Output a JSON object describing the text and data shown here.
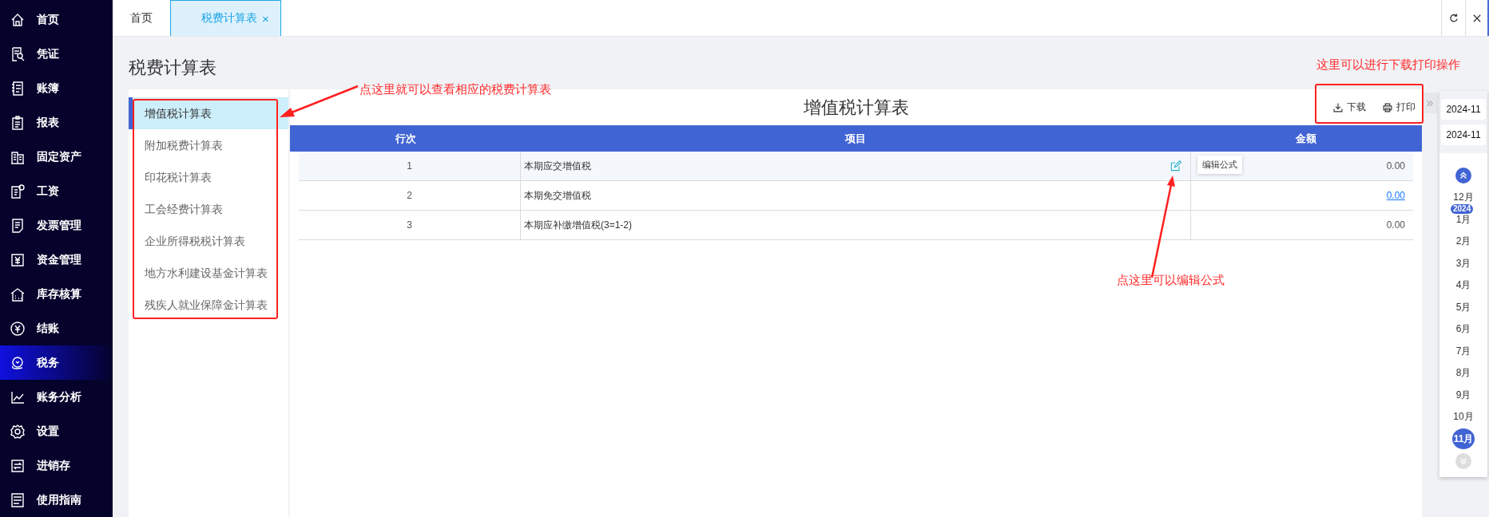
{
  "sidebar": {
    "items": [
      {
        "label": "首页",
        "selected": false
      },
      {
        "label": "凭证",
        "selected": false
      },
      {
        "label": "账簿",
        "selected": false
      },
      {
        "label": "报表",
        "selected": false
      },
      {
        "label": "固定资产",
        "selected": false
      },
      {
        "label": "工资",
        "selected": false
      },
      {
        "label": "发票管理",
        "selected": false
      },
      {
        "label": "资金管理",
        "selected": false
      },
      {
        "label": "库存核算",
        "selected": false
      },
      {
        "label": "结账",
        "selected": false
      },
      {
        "label": "税务",
        "selected": true
      },
      {
        "label": "账务分析",
        "selected": false
      },
      {
        "label": "设置",
        "selected": false
      },
      {
        "label": "进销存",
        "selected": false
      },
      {
        "label": "使用指南",
        "selected": false
      }
    ]
  },
  "tabs": [
    {
      "label": "首页",
      "selected": false,
      "closable": false
    },
    {
      "label": "税费计算表",
      "selected": true,
      "closable": true
    }
  ],
  "tab_close": "×",
  "page_title": "税费计算表",
  "report_list": [
    {
      "label": "增值税计算表",
      "selected": true
    },
    {
      "label": "附加税费计算表",
      "selected": false
    },
    {
      "label": "印花税计算表",
      "selected": false
    },
    {
      "label": "工会经费计算表",
      "selected": false
    },
    {
      "label": "企业所得税税计算表",
      "selected": false
    },
    {
      "label": "地方水利建设基金计算表",
      "selected": false
    },
    {
      "label": "残疾人就业保障金计算表",
      "selected": false
    }
  ],
  "report": {
    "title": "增值税计算表",
    "actions": [
      {
        "label": "下载",
        "kind": "download"
      },
      {
        "label": "打印",
        "kind": "print"
      }
    ],
    "columns": [
      "行次",
      "项目",
      "金额"
    ],
    "rows": [
      {
        "line": "1",
        "item": "本期应交增值税",
        "amount": "0.00",
        "amount_link": false,
        "hovered": true
      },
      {
        "line": "2",
        "item": "本期免交增值税",
        "amount": "0.00",
        "amount_link": true,
        "hovered": false
      },
      {
        "line": "3",
        "item": "本期应补缴增值税(3=1-2)",
        "amount": "0.00",
        "amount_link": false,
        "hovered": false
      }
    ],
    "edit_tooltip": "编辑公式"
  },
  "expand_toggle": "»",
  "period": {
    "start": "2024-11",
    "end": "2024-11",
    "months": [
      {
        "label": "12月",
        "selected": false
      },
      {
        "label": "1月",
        "selected": false,
        "year_badge": "2024"
      },
      {
        "label": "2月",
        "selected": false
      },
      {
        "label": "3月",
        "selected": false
      },
      {
        "label": "4月",
        "selected": false
      },
      {
        "label": "5月",
        "selected": false
      },
      {
        "label": "6月",
        "selected": false
      },
      {
        "label": "7月",
        "selected": false
      },
      {
        "label": "8月",
        "selected": false
      },
      {
        "label": "9月",
        "selected": false
      },
      {
        "label": "10月",
        "selected": false
      },
      {
        "label": "11月",
        "selected": true
      }
    ]
  },
  "annotations": [
    {
      "text": "点这里就可以查看相应的税费计算表"
    },
    {
      "text": "这里可以进行下载打印操作"
    },
    {
      "text": "点这里可以编辑公式"
    }
  ]
}
